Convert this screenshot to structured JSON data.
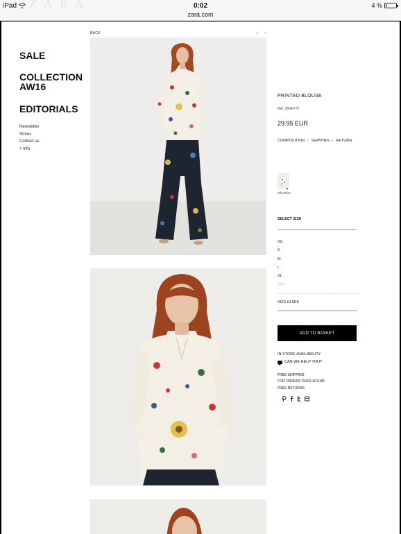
{
  "status_bar": {
    "device": "iPad",
    "time": "0:02",
    "url": "zara.com",
    "battery_text": "4 %",
    "battery_level": 0.04,
    "ghost_logo": "ZARA"
  },
  "nav": {
    "sale": "SALE",
    "collection": "COLLECTION AW16",
    "editorials": "EDITORIALS",
    "links": [
      "Newsletter",
      "Stores",
      "Contact us",
      "+ Info"
    ]
  },
  "gallery": {
    "back": "BACK",
    "pager": "◂ ▸"
  },
  "product": {
    "name": "PRINTED BLOUSE",
    "ref": "Ref. 2804/772",
    "price": "29.95 EUR",
    "tabs": [
      "COMPOSITION",
      "SHIPPING",
      "RETURN"
    ],
    "color_label": "Off-White",
    "size_title": "SELECT SIZE",
    "sizes": [
      "XS",
      "S",
      "M",
      "L",
      "XL",
      "XXL"
    ],
    "size_guide": "SIZE GUIDE",
    "add_to_basket": "ADD TO BASKET",
    "in_store": "IN STORE AVAILABILITY",
    "help": "CAN WE HELP YOU?",
    "shipping_lines": [
      "FREE SHIPPING",
      "FOR ORDERS OVER 30 EUR",
      "FREE RETURNS"
    ]
  },
  "colors": {
    "accent": "#000000",
    "background": "#ffffff",
    "photo_bg": "#ecebe9"
  }
}
